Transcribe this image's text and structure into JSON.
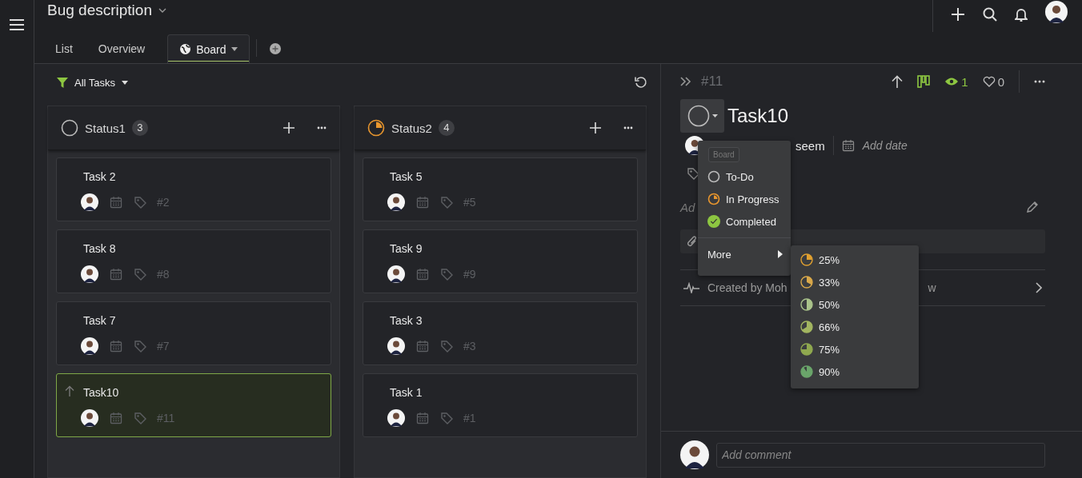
{
  "header": {
    "title": "Bug description",
    "tabs": [
      {
        "label": "List",
        "selected": false,
        "icon": false
      },
      {
        "label": "Overview",
        "selected": false,
        "icon": false
      },
      {
        "label": "Board",
        "selected": true,
        "icon": true
      }
    ]
  },
  "toolbar": {
    "filter": "All Tasks"
  },
  "columns": [
    {
      "name": "Status1",
      "count": "3",
      "kind": "todo",
      "cards": [
        {
          "title": "Task 2",
          "number": "#2",
          "selected": false,
          "priority": false
        },
        {
          "title": "Task 8",
          "number": "#8",
          "selected": false,
          "priority": false
        },
        {
          "title": "Task 7",
          "number": "#7",
          "selected": false,
          "priority": false
        },
        {
          "title": "Task10",
          "number": "#11",
          "selected": true,
          "priority": true
        }
      ]
    },
    {
      "name": "Status2",
      "count": "4",
      "kind": "progress",
      "cards": [
        {
          "title": "Task 5",
          "number": "#5",
          "selected": false,
          "priority": false
        },
        {
          "title": "Task 9",
          "number": "#9",
          "selected": false,
          "priority": false
        },
        {
          "title": "Task 3",
          "number": "#3",
          "selected": false,
          "priority": false
        },
        {
          "title": "Task 1",
          "number": "#1",
          "selected": false,
          "priority": false
        }
      ]
    }
  ],
  "detail": {
    "number": "#11",
    "watchers": "1",
    "likes": "0",
    "title": "Task10",
    "assignee": "seem",
    "date_placeholder": "Add date",
    "description": "Ad",
    "activity": "Created by Moh",
    "activity_tail": "w",
    "comment_placeholder": "Add comment"
  },
  "status_menu": {
    "section": "Board",
    "items": [
      {
        "label": "To-Do",
        "kind": "todo"
      },
      {
        "label": "In Progress",
        "kind": "progress"
      },
      {
        "label": "Completed",
        "kind": "done"
      }
    ],
    "more": "More",
    "submenu": [
      {
        "label": "25%",
        "kind": "quarter",
        "color": "#e0a030"
      },
      {
        "label": "33%",
        "kind": "third",
        "color": "#d9a84a"
      },
      {
        "label": "50%",
        "kind": "half",
        "color": "#a9c28a"
      },
      {
        "label": "66%",
        "kind": "two-thirds",
        "color": "#a2b560"
      },
      {
        "label": "75%",
        "kind": "three-quarters",
        "color": "#8fa84f"
      },
      {
        "label": "90%",
        "kind": "nearly-full",
        "color": "#6aa56a"
      }
    ]
  }
}
